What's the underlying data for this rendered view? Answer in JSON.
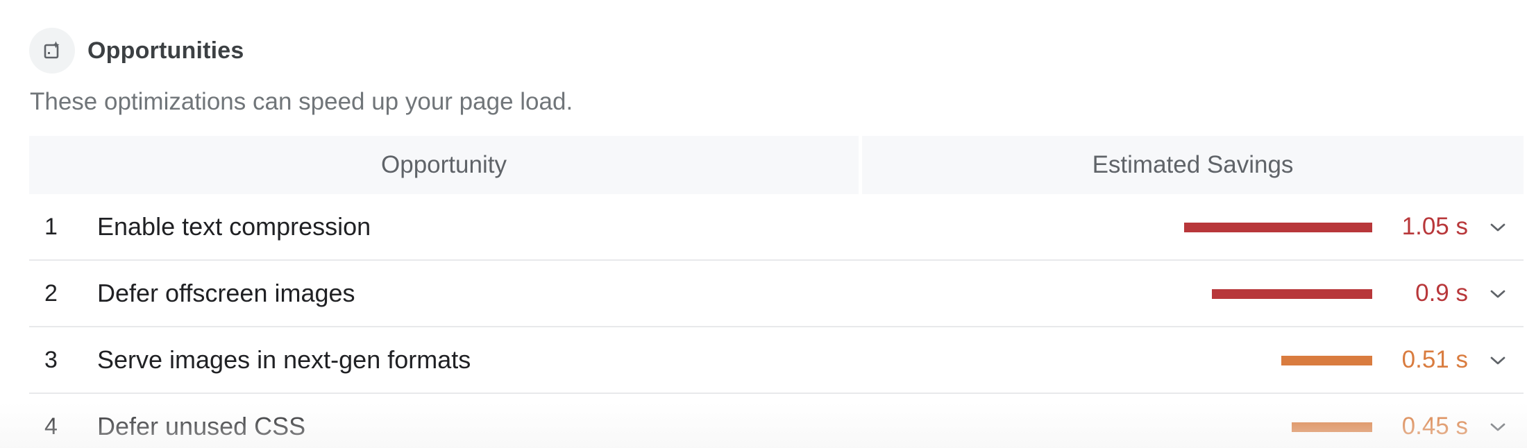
{
  "header": {
    "icon": "sparkle-document-icon",
    "title": "Opportunities"
  },
  "description": "These optimizations can speed up your page load.",
  "table": {
    "columns": [
      "Opportunity",
      "Estimated Savings"
    ],
    "rows": [
      {
        "num": "1",
        "title": "Enable text compression",
        "value": "1.05 s",
        "savings_fraction": 0.645,
        "color": "#b8373a"
      },
      {
        "num": "2",
        "title": "Defer offscreen images",
        "value": "0.9 s",
        "savings_fraction": 0.55,
        "color": "#b8373a"
      },
      {
        "num": "3",
        "title": "Serve images in next-gen formats",
        "value": "0.51 s",
        "savings_fraction": 0.312,
        "color": "#d97c3f"
      },
      {
        "num": "4",
        "title": "Defer unused CSS",
        "value": "0.45 s",
        "savings_fraction": 0.275,
        "color": "#d97c3f"
      }
    ]
  },
  "icons": {
    "row_expand": "chevron-down-icon"
  }
}
